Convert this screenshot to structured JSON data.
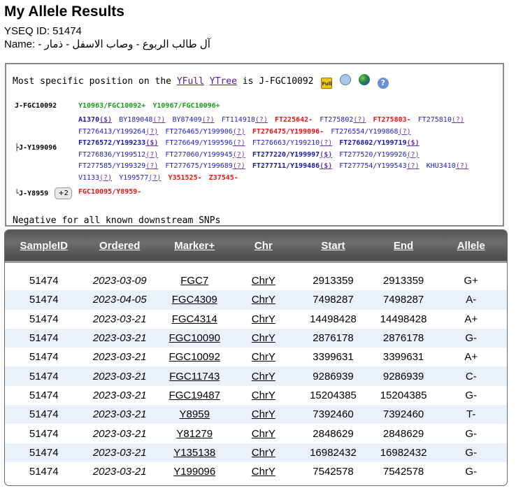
{
  "header": {
    "title": "My Allele Results",
    "yseq_id_label": "YSEQ ID: 51474",
    "name_label": "Name: - آل طالب الربوع - وصاب الاسفل - ذمار"
  },
  "tree": {
    "msp_prefix": "Most specific position on the",
    "yfull_link": "YFull",
    "ytree_link": "YTree",
    "msp_suffix": "is J-FGC10092",
    "full_icon_text": "Full",
    "help_icon_text": "?",
    "nodes": [
      {
        "name": "J-FGC10092",
        "snps": [
          {
            "t": "Y10963/FGC10092+",
            "c": "green"
          },
          {
            "t": "Y10967/FGC10096+",
            "c": "green"
          }
        ]
      },
      {
        "name": "├J-Y199096",
        "snps": [
          {
            "t": "A1370",
            "q": "($)",
            "c": "blueb"
          },
          {
            "t": "BY189048",
            "q": "(?)",
            "c": "blue"
          },
          {
            "t": "BY87409",
            "q": "(?)",
            "c": "blue"
          },
          {
            "t": "FT114918",
            "q": "(?)",
            "c": "blue"
          },
          {
            "t": "FT225642-",
            "c": "red"
          },
          {
            "t": "FT275802",
            "q": "(?)",
            "c": "blue"
          },
          {
            "t": "FT275803-",
            "c": "red"
          },
          {
            "t": "FT275810",
            "q": "(?)",
            "c": "blue"
          },
          {
            "t": "FT276413/Y199264",
            "q": "(?)",
            "c": "blue"
          },
          {
            "t": "FT276465/Y199906",
            "q": "(?)",
            "c": "blue"
          },
          {
            "t": "FT276475/Y199096-",
            "c": "red"
          },
          {
            "t": "FT276554/Y199868",
            "q": "(?)",
            "c": "blue"
          },
          {
            "t": "FT276572/Y199233",
            "q": "($)",
            "c": "blueb"
          },
          {
            "t": "FT276649/Y199596",
            "q": "(?)",
            "c": "blue"
          },
          {
            "t": "FT276663/Y199210",
            "q": "(?)",
            "c": "blue"
          },
          {
            "t": "FT276802/Y199719",
            "q": "($)",
            "c": "blueb"
          },
          {
            "t": "FT276836/Y199512",
            "q": "(?)",
            "c": "blue"
          },
          {
            "t": "FT277060/Y199945",
            "q": "(?)",
            "c": "blue"
          },
          {
            "t": "FT277220/Y199997",
            "q": "($)",
            "c": "blueb"
          },
          {
            "t": "FT277520/Y199926",
            "q": "(?)",
            "c": "blue"
          },
          {
            "t": "FT277585/Y199329",
            "q": "(?)",
            "c": "blue"
          },
          {
            "t": "FT277675/Y199689",
            "q": "(?)",
            "c": "blue"
          },
          {
            "t": "FT277711/Y199486",
            "q": "($)",
            "c": "blueb"
          },
          {
            "t": "FT277754/Y199543",
            "q": "(?)",
            "c": "blue"
          },
          {
            "t": "KHU3410",
            "q": "(?)",
            "c": "blue"
          },
          {
            "t": "V1133",
            "q": "(?)",
            "c": "blue"
          },
          {
            "t": "Y199577",
            "q": "(?)",
            "c": "blue"
          },
          {
            "t": "Y351525-",
            "c": "red"
          },
          {
            "t": "Z37545-",
            "c": "red"
          }
        ]
      },
      {
        "name": "└J-Y8959",
        "plus": "+2",
        "snps": [
          {
            "t": "FGC10095/Y8959-",
            "c": "red"
          }
        ]
      }
    ],
    "negative_text": "Negative for all known downstream SNPs"
  },
  "table": {
    "headers": [
      "SampleID",
      "Ordered",
      "Marker+",
      "Chr",
      "Start",
      "End",
      "Allele"
    ],
    "rows": [
      [
        "51474",
        "2023-03-09",
        "FGC7",
        "ChrY",
        "2913359",
        "2913359",
        "G+"
      ],
      [
        "51474",
        "2023-04-05",
        "FGC4309",
        "ChrY",
        "7498287",
        "7498287",
        "A-"
      ],
      [
        "51474",
        "2023-03-21",
        "FGC4314",
        "ChrY",
        "14498428",
        "14498428",
        "A+"
      ],
      [
        "51474",
        "2023-03-21",
        "FGC10090",
        "ChrY",
        "2876178",
        "2876178",
        "G-"
      ],
      [
        "51474",
        "2023-03-21",
        "FGC10092",
        "ChrY",
        "3399631",
        "3399631",
        "A+"
      ],
      [
        "51474",
        "2023-03-21",
        "FGC11743",
        "ChrY",
        "9286939",
        "9286939",
        "C-"
      ],
      [
        "51474",
        "2023-03-21",
        "FGC19487",
        "ChrY",
        "15204385",
        "15204385",
        "G-"
      ],
      [
        "51474",
        "2023-03-21",
        "Y8959",
        "ChrY",
        "7392460",
        "7392460",
        "T-"
      ],
      [
        "51474",
        "2023-03-21",
        "Y81279",
        "ChrY",
        "2848629",
        "2848629",
        "G-"
      ],
      [
        "51474",
        "2023-03-21",
        "Y135138",
        "ChrY",
        "16982432",
        "16982432",
        "G-"
      ],
      [
        "51474",
        "2023-03-21",
        "Y199096",
        "ChrY",
        "7542578",
        "7542578",
        "G-"
      ]
    ]
  }
}
